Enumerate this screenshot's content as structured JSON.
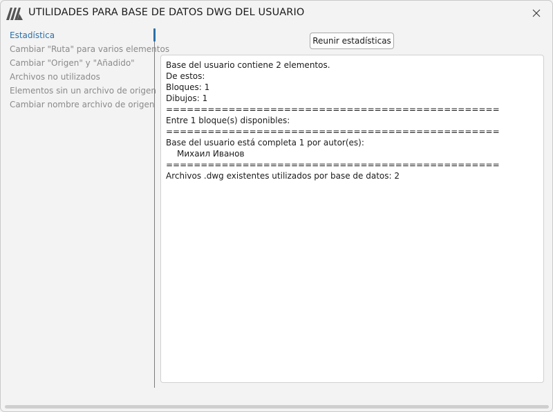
{
  "window": {
    "title": "UTILIDADES PARA BASE DE DATOS DWG DEL USUARIO",
    "accent_color": "#2b6fa8"
  },
  "sidebar": {
    "items": [
      {
        "label": "Estadística",
        "active": true
      },
      {
        "label": "Cambiar \"Ruta\" para varios elementos",
        "active": false
      },
      {
        "label": "Cambiar \"Origen\" y \"Añadido\"",
        "active": false
      },
      {
        "label": "Archivos no utilizados",
        "active": false
      },
      {
        "label": "Elementos sin un archivo de origen",
        "active": false
      },
      {
        "label": "Cambiar nombre archivo de origen",
        "active": false
      }
    ]
  },
  "main": {
    "gather_button_label": "Reunir estadísticas",
    "output_lines": [
      "Base del usuario contiene 2 elementos.",
      "De estos:",
      "Bloques: 1",
      "Dibujos: 1",
      "================================================",
      "Entre 1 bloque(s) disponibles:",
      "================================================",
      "Base del usuario está completa 1 por autor(es):",
      "Михаил Иванов",
      "================================================",
      "Archivos .dwg existentes utilizados por base de datos: 2"
    ]
  }
}
